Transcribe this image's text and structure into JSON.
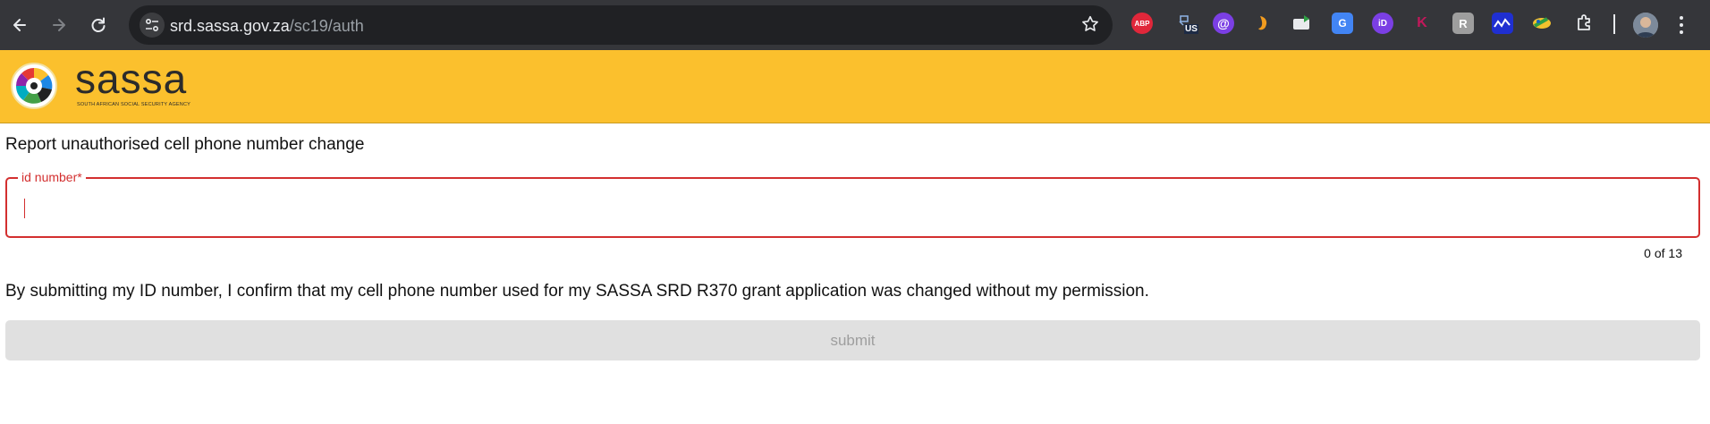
{
  "browser": {
    "url_host": "srd.sassa.gov.za",
    "url_path": "/sc19/auth",
    "extensions": [
      {
        "name": "adblock-plus-icon",
        "label": "ABP",
        "color": "#e0273a"
      },
      {
        "name": "vpn-us-icon",
        "label": "US",
        "color": "#2b5ba8"
      },
      {
        "name": "at-sign-extension-icon",
        "label": "@",
        "color": "#7b3fe4"
      },
      {
        "name": "orange-extension-icon",
        "label": "",
        "color": "#f29c1f"
      },
      {
        "name": "green-mail-extension-icon",
        "label": "",
        "color": "#e8eaed"
      },
      {
        "name": "google-translate-icon",
        "label": "G",
        "color": "#4285f4"
      },
      {
        "name": "id-extension-icon",
        "label": "iD",
        "color": "#7b3fe4"
      },
      {
        "name": "k-extension-icon",
        "label": "K",
        "color": "#35363a"
      },
      {
        "name": "r-extension-icon",
        "label": "R",
        "color": "#9e9e9e"
      },
      {
        "name": "wave-extension-icon",
        "label": "",
        "color": "#1f2fd1"
      },
      {
        "name": "brush-extension-icon",
        "label": "",
        "color": "#35363a"
      },
      {
        "name": "puzzle-extensions-icon",
        "label": "",
        "color": "#35363a"
      }
    ]
  },
  "header": {
    "brand": "sassa",
    "tagline": "SOUTH AFRICAN SOCIAL SECURITY AGENCY",
    "background": "#fbc02d"
  },
  "form": {
    "title": "Report unauthorised cell phone number change",
    "id_label": "id number*",
    "id_value": "",
    "counter": "0 of 13",
    "confirmation": "By submitting my ID number, I confirm that my cell phone number used for my SASSA SRD R370 grant application was changed without my permission.",
    "submit_label": "submit",
    "error_color": "#d32f2f"
  }
}
